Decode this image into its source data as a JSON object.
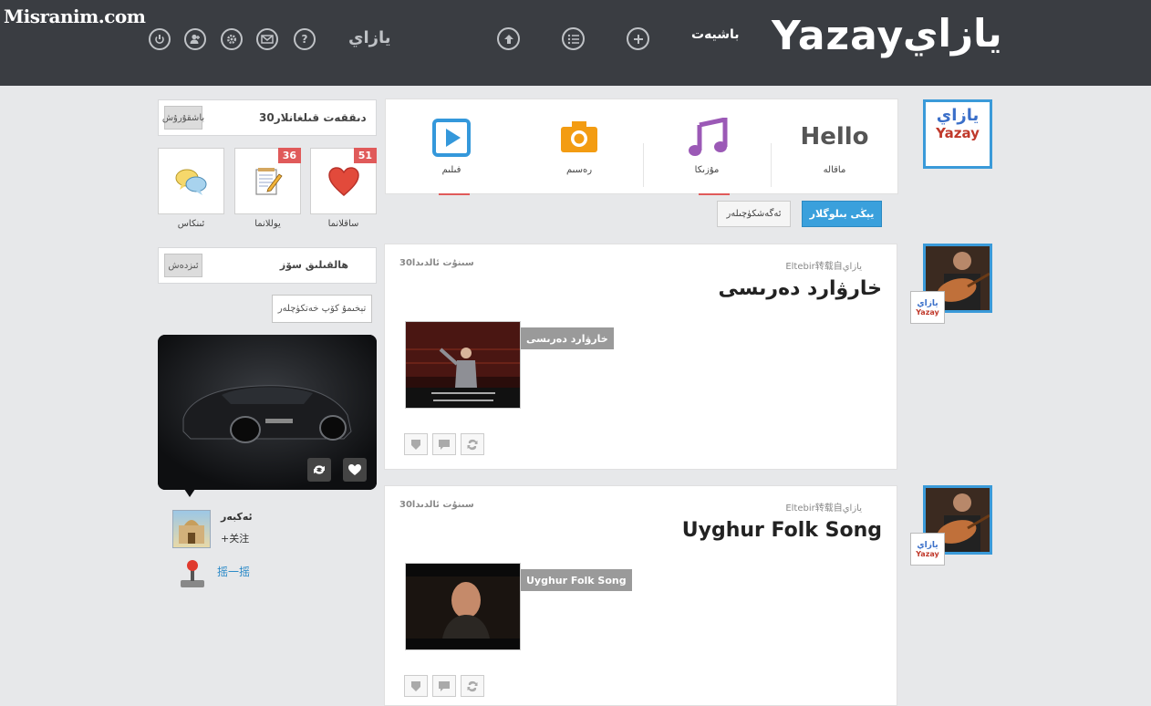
{
  "watermark": "Misranim.com",
  "header": {
    "brand_small": "يازاي",
    "home_link": "باشيەت",
    "logo_latin": "Yazay",
    "logo_arabic": "يازاي",
    "icons": [
      "power-icon",
      "add-user-icon",
      "gear-icon",
      "mail-icon",
      "help-icon",
      "upload-icon",
      "list-icon",
      "plus-icon"
    ],
    "help_glyph": "?"
  },
  "user_panel": {
    "stat_text": "دىققەت قىلغانلار30",
    "edit_button": "باشقۇرۇش",
    "tiles": [
      {
        "label": "ساقلانما",
        "badge": "51",
        "icon": "heart-icon"
      },
      {
        "label": "يوللانما",
        "badge": "36",
        "icon": "notepad-icon"
      },
      {
        "label": "ئىنكاس",
        "badge": "",
        "icon": "chat-bubbles-icon"
      }
    ]
  },
  "hot_words": {
    "label": "ھالقىلىق سۆز",
    "button": "ئىزدەش"
  },
  "tag_button": "تېخىمۇ كۆپ خەتكۈچلەر",
  "promo": {
    "user_name": "ئەكبەر",
    "follow_text": "+关注",
    "shake_text": "摇一摇"
  },
  "tabs": [
    {
      "label": "ماقالە",
      "icon_text": "Hello",
      "icon": "hello-text-icon"
    },
    {
      "label": "مۇزىكا",
      "icon": "music-note-icon",
      "color": "#9b59b6"
    },
    {
      "label": "رەسىم",
      "icon": "camera-icon",
      "color": "#f39c12"
    },
    {
      "label": "فىلىم",
      "icon": "play-icon",
      "color": "#3498db"
    }
  ],
  "buttons": {
    "new_blogs": "يېڭى بىلوگلار",
    "tags": "ئەگەشكۈچىلەر"
  },
  "posts": [
    {
      "meta_left": "30سىنۇت ئالدىدا",
      "meta_right": "Eltebir转载自يازاي",
      "title": "خارۋارد دەرىسى",
      "caption": "خارۋارد دەرىسى"
    },
    {
      "meta_left": "30سىنۇت ئالدىدا",
      "meta_right": "Eltebir转载自يازاي",
      "title": "Uyghur Folk Song",
      "caption": "Uyghur Folk Song"
    }
  ],
  "mini_logo": {
    "arabic": "يازاي",
    "latin": "Yazay"
  }
}
